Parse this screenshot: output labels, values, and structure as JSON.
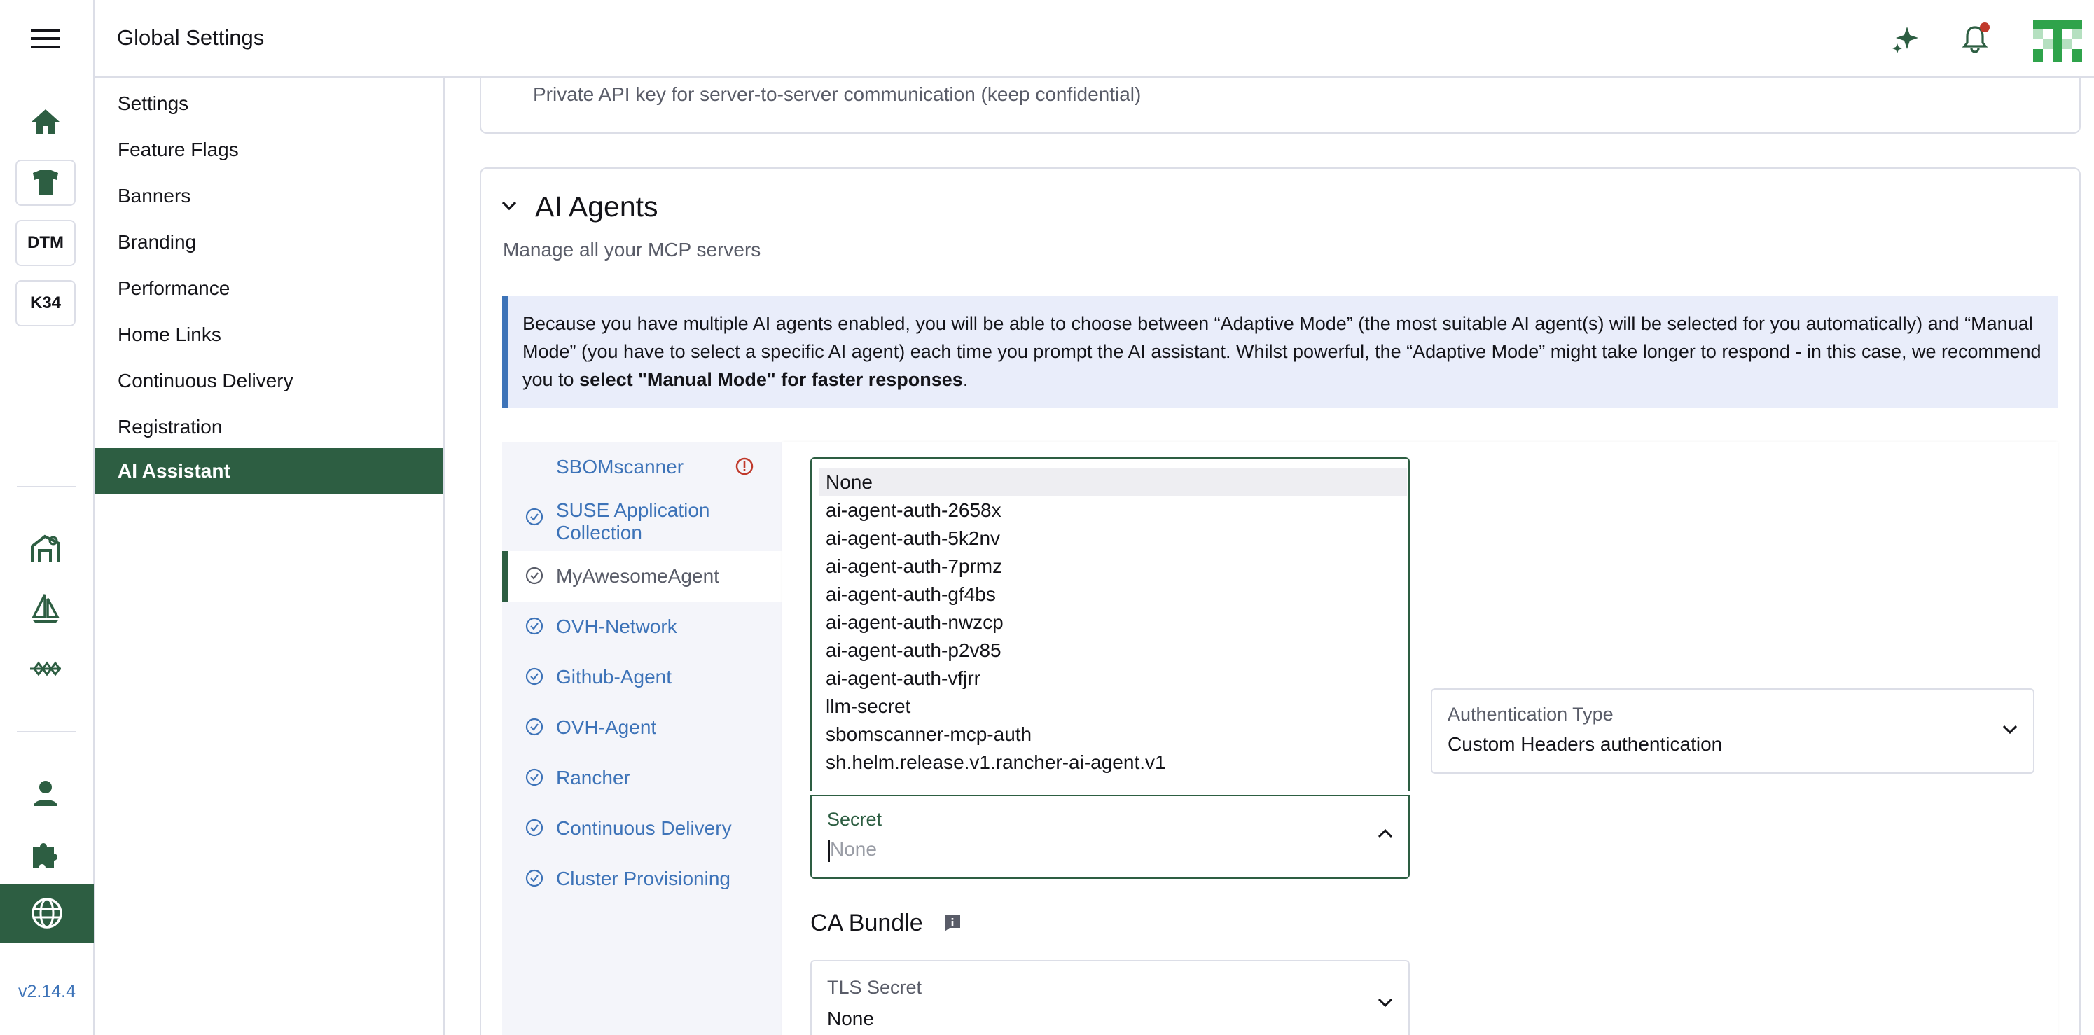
{
  "header": {
    "title": "Global Settings"
  },
  "rail": {
    "labels": [
      "DTM",
      "K34"
    ],
    "version": "v2.14.4"
  },
  "sidebar": {
    "items": [
      {
        "label": "Settings"
      },
      {
        "label": "Feature Flags"
      },
      {
        "label": "Banners"
      },
      {
        "label": "Branding"
      },
      {
        "label": "Performance"
      },
      {
        "label": "Home Links"
      },
      {
        "label": "Continuous Delivery"
      },
      {
        "label": "Registration"
      },
      {
        "label": "AI Assistant"
      }
    ]
  },
  "top_card": {
    "description": "Private API key for server-to-server communication (keep confidential)"
  },
  "section": {
    "title": "AI Agents",
    "subtitle": "Manage all your MCP servers",
    "banner_text": "Because you have multiple AI agents enabled, you will be able to choose between “Adaptive Mode” (the most suitable AI agent(s) will be selected for you automatically) and “Manual Mode” (you have to select a specific AI agent) each time you prompt the AI assistant. Whilst powerful, the “Adaptive Mode” might take longer to respond - in this case, we recommend you to ",
    "banner_bold": "select \"Manual Mode\" for faster responses",
    "banner_end": "."
  },
  "agents": [
    {
      "label": "SBOMscanner",
      "status": "error"
    },
    {
      "label": "SUSE Application Collection",
      "status": "ok"
    },
    {
      "label": "MyAwesomeAgent",
      "status": "ok"
    },
    {
      "label": "OVH-Network",
      "status": "ok"
    },
    {
      "label": "Github-Agent",
      "status": "ok"
    },
    {
      "label": "OVH-Agent",
      "status": "ok"
    },
    {
      "label": "Rancher",
      "status": "ok"
    },
    {
      "label": "Continuous Delivery",
      "status": "ok"
    },
    {
      "label": "Cluster Provisioning",
      "status": "ok"
    }
  ],
  "secret_select": {
    "label": "Secret",
    "placeholder": "None",
    "options": [
      "None",
      "ai-agent-auth-2658x",
      "ai-agent-auth-5k2nv",
      "ai-agent-auth-7prmz",
      "ai-agent-auth-gf4bs",
      "ai-agent-auth-nwzcp",
      "ai-agent-auth-p2v85",
      "ai-agent-auth-vfjrr",
      "llm-secret",
      "sbomscanner-mcp-auth",
      "sh.helm.release.v1.rancher-ai-agent.v1"
    ]
  },
  "auth_type": {
    "label": "Authentication Type",
    "value": "Custom Headers authentication"
  },
  "ca_bundle": {
    "title": "CA Bundle"
  },
  "tls_secret": {
    "label": "TLS Secret",
    "value": "None"
  },
  "colors": {
    "accent": "#2d5e42",
    "link": "#3d73b8",
    "error": "#c0392b",
    "banner_bg": "#e9edfa"
  }
}
